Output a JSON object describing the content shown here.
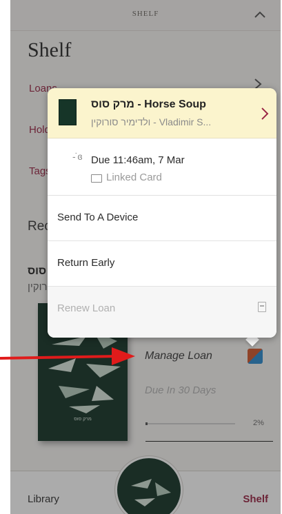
{
  "header": {
    "title": "SHELF"
  },
  "shelf": {
    "title": "Shelf",
    "rows": [
      {
        "label": "Loans"
      },
      {
        "label": "Holds"
      },
      {
        "label": "Tags"
      }
    ],
    "recent_heading": "Recent",
    "bg_book_title": "סוס",
    "bg_book_author": "סורוקין"
  },
  "book_card": {
    "manage_label": "Manage Loan",
    "due_days": "Due In 30 Days",
    "progress_pct": "2%",
    "progress_fraction": 0.02,
    "cover_text": "מרק סוס"
  },
  "popup": {
    "title": "מרק סוס - Horse Soup",
    "subtitle": "ולדימיר סורוקין - Vladimir S...",
    "due_text": "Due 11:46am, 7 Mar",
    "card_text": "Linked Card",
    "menu": [
      {
        "label": "Send To A Device"
      },
      {
        "label": "Return Early"
      },
      {
        "label": "Renew Loan"
      }
    ]
  },
  "tabbar": {
    "library": "Library",
    "shelf": "Shelf"
  },
  "colors": {
    "accent": "#9a2645",
    "highlight": "#fbf4cd",
    "cover": "#163528",
    "annotation_arrow": "#e01b1b"
  }
}
